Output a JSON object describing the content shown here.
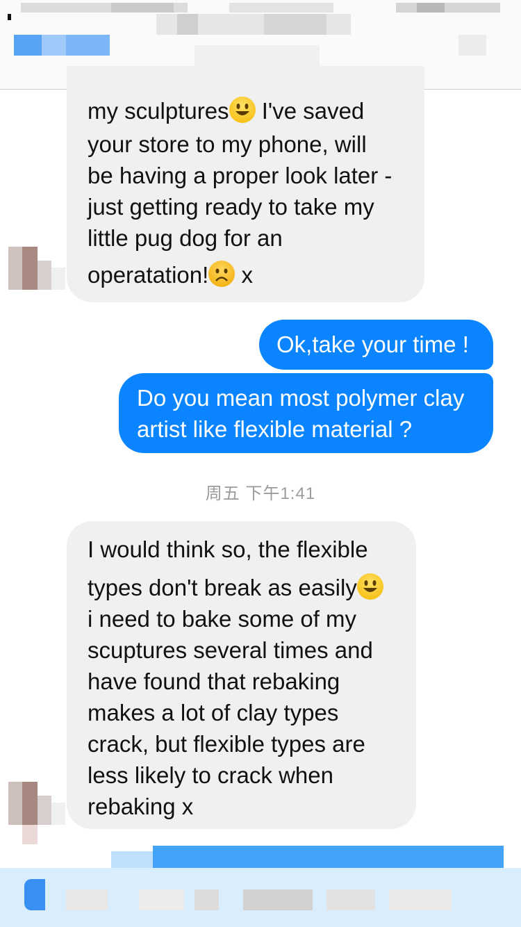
{
  "header": {
    "status_left": "",
    "contact_name": "",
    "back_label": ""
  },
  "messages": [
    {
      "side": "incoming",
      "lines": [
        {
          "text": "my sculptures",
          "emoji": "smile-icon",
          "after": " I've saved"
        },
        {
          "text": "your store to my phone, will"
        },
        {
          "text": "be having a proper look later -"
        },
        {
          "text": "just getting ready to take my"
        },
        {
          "text": "little pug dog for an"
        },
        {
          "text": "operatation!",
          "emoji": "sad-icon",
          "after": " x"
        }
      ]
    },
    {
      "side": "outgoing",
      "lines": [
        {
          "text": "Ok,take your time !"
        }
      ]
    },
    {
      "side": "outgoing",
      "lines": [
        {
          "text": "Do you mean most polymer clay"
        },
        {
          "text": "artist like flexible material ?"
        }
      ]
    },
    {
      "side": "incoming",
      "lines": [
        {
          "text": "I would think so, the flexible"
        },
        {
          "text": "types don't break as easily",
          "emoji": "smile-icon",
          "after": ""
        },
        {
          "text": "i need to bake some of my"
        },
        {
          "text": "scuptures several times and"
        },
        {
          "text": "have found that rebaking"
        },
        {
          "text": "makes a lot of clay types"
        },
        {
          "text": "crack, but flexible types are"
        },
        {
          "text": "less likely to crack when"
        },
        {
          "text": "rebaking x"
        }
      ]
    }
  ],
  "timestamp": "周五 下午1:41",
  "colors": {
    "outgoing_bubble": "#0a84ff",
    "incoming_bubble": "#f0f0f0",
    "link_blue": "#0a84ff"
  }
}
